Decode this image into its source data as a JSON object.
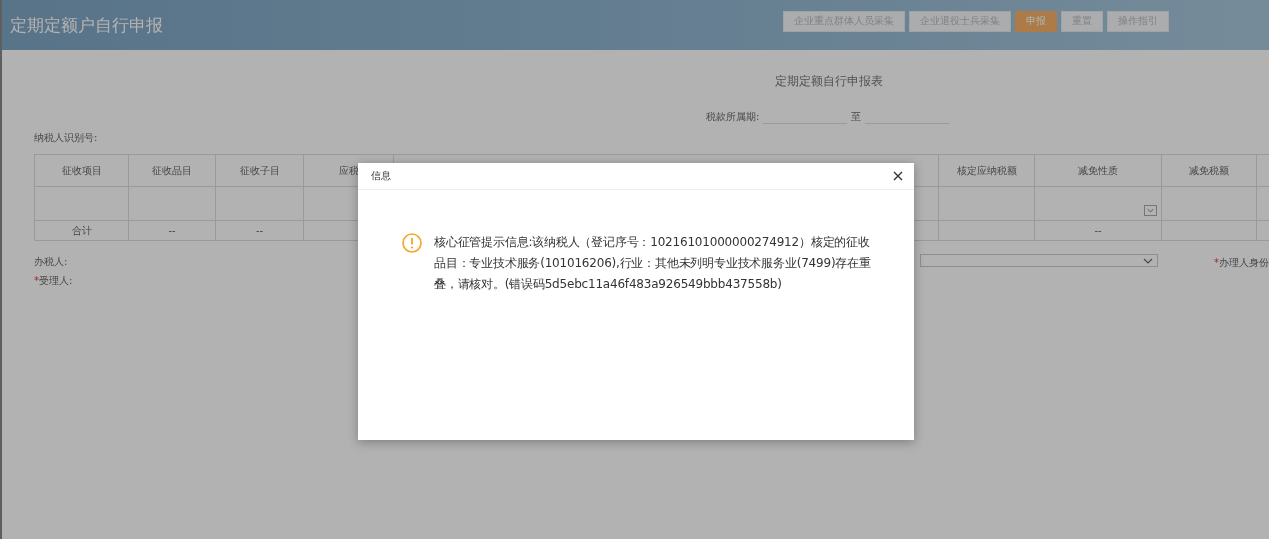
{
  "page": {
    "title": "定期定额户自行申报"
  },
  "toolbar": {
    "buttons": [
      {
        "label": "企业重点群体人员采集",
        "kind": "normal"
      },
      {
        "label": "企业退役士兵采集",
        "kind": "normal"
      },
      {
        "label": "申报",
        "kind": "primary"
      },
      {
        "label": "重置",
        "kind": "normal"
      },
      {
        "label": "操作指引",
        "kind": "normal"
      }
    ]
  },
  "form": {
    "title": "定期定额自行申报表",
    "period": {
      "label": "税款所属期:",
      "separator": "至"
    },
    "taxpayer_id_label": "纳税人识别号:",
    "table": {
      "columns": [
        {
          "header": "征收项目",
          "kind": "text",
          "total": "合计"
        },
        {
          "header": "征收品目",
          "kind": "text",
          "total": "--"
        },
        {
          "header": "征收子目",
          "kind": "text",
          "total": "--"
        },
        {
          "header": "应税",
          "kind": "text"
        },
        {
          "header": "核定应纳税额",
          "kind": "text"
        },
        {
          "header": "减免性质",
          "kind": "select",
          "total": "--"
        },
        {
          "header": "减免税额",
          "kind": "text"
        }
      ]
    },
    "fields": [
      {
        "label": "办税人:"
      },
      {
        "label": "受理人:",
        "required_mark": "*"
      }
    ],
    "id_field": {
      "label": "办理人身份",
      "required_mark": "*"
    }
  },
  "dialog": {
    "title": "信息",
    "message": "核心征管提示信息:该纳税人（登记序号：10216101000000274912）核定的征收品目：专业技术服务(101016206),行业：其他未列明专业技术服务业(7499)存在重叠，请核对。(错误码5d5ebc11a46f483a926549bbb437558b)"
  }
}
